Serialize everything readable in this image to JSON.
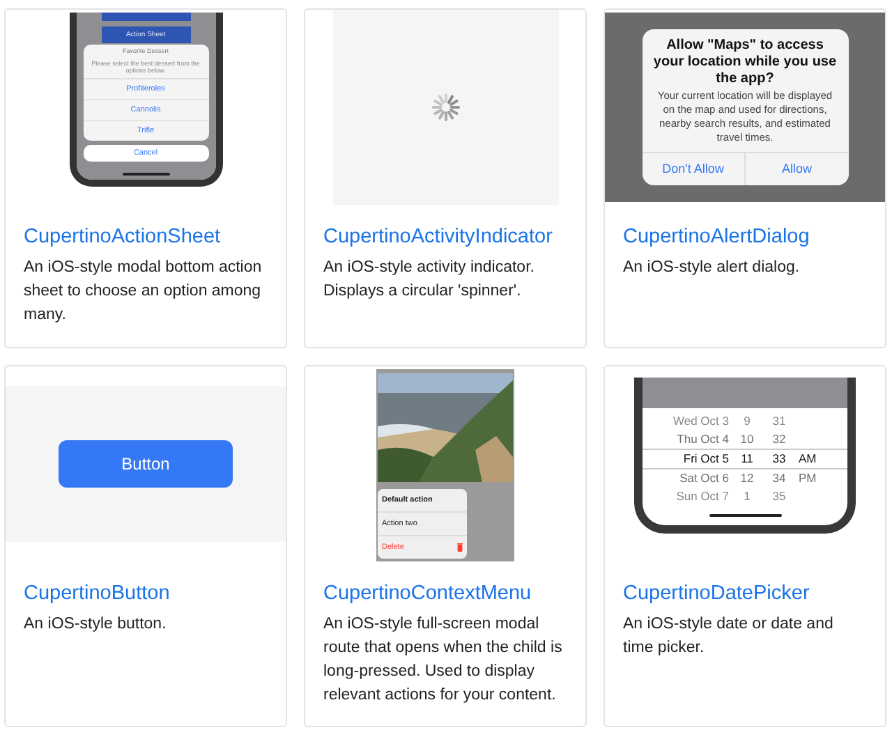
{
  "cards": [
    {
      "title": "CupertinoActionSheet",
      "description": "An iOS-style modal bottom action sheet to choose an option among many.",
      "preview": {
        "kind": "action_sheet",
        "button_label": "Action Sheet",
        "sheet_title": "Favorite Dessert",
        "message": "Please select the best dessert from the options below.",
        "actions": [
          "Profiteroles",
          "Cannolis",
          "Trifle"
        ],
        "cancel": "Cancel"
      }
    },
    {
      "title": "CupertinoActivityIndicator",
      "description": "An iOS-style activity indicator. Displays a circular 'spinner'.",
      "preview": {
        "kind": "activity_indicator"
      }
    },
    {
      "title": "CupertinoAlertDialog",
      "description": "An iOS-style alert dialog.",
      "preview": {
        "kind": "alert",
        "title": "Allow \"Maps\" to access your location while you use the app?",
        "message": "Your current location will be displayed on the map and used for directions, nearby search results, and estimated travel times.",
        "actions": [
          "Don't Allow",
          "Allow"
        ]
      }
    },
    {
      "title": "CupertinoButton",
      "description": "An iOS-style button.",
      "preview": {
        "kind": "button",
        "label": "Button"
      }
    },
    {
      "title": "CupertinoContextMenu",
      "description": "An iOS-style full-screen modal route that opens when the child is long-pressed. Used to display relevant actions for your content.",
      "preview": {
        "kind": "context_menu",
        "actions": [
          {
            "label": "Default action",
            "kind": "default"
          },
          {
            "label": "Action two",
            "kind": "normal"
          },
          {
            "label": "Delete",
            "kind": "destructive"
          }
        ]
      }
    },
    {
      "title": "CupertinoDatePicker",
      "description": "An iOS-style date or date and time picker.",
      "preview": {
        "kind": "date_picker",
        "rows": [
          {
            "cells": [
              "Wed Oct 3",
              "9",
              "31",
              ""
            ],
            "selected": false
          },
          {
            "cells": [
              "Thu Oct 4",
              "10",
              "32",
              ""
            ],
            "selected": false
          },
          {
            "cells": [
              "Fri Oct 5",
              "11",
              "33",
              "AM"
            ],
            "selected": true
          },
          {
            "cells": [
              "Sat Oct 6",
              "12",
              "34",
              "PM"
            ],
            "selected": false
          },
          {
            "cells": [
              "Sun Oct 7",
              "1",
              "35",
              ""
            ],
            "selected": false
          }
        ]
      }
    }
  ]
}
